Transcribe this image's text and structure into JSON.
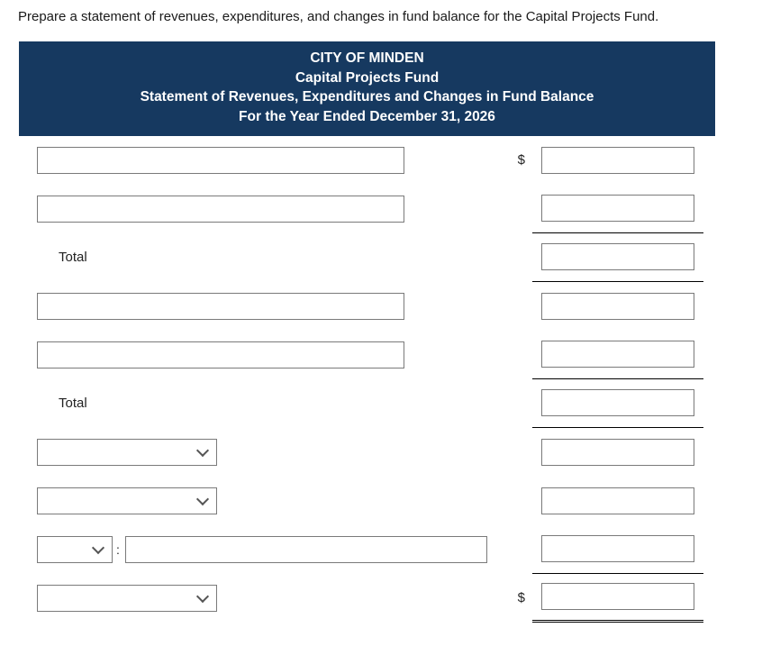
{
  "instruction": "Prepare a statement of revenues, expenditures, and changes in fund balance for the Capital Projects Fund.",
  "header": {
    "line1": "CITY OF MINDEN",
    "line2": "Capital Projects Fund",
    "line3": "Statement of Revenues, Expenditures and Changes in Fund Balance",
    "line4": "For the Year Ended December 31, 2026"
  },
  "symbols": {
    "dollar": "$",
    "colon": ":"
  },
  "labels": {
    "total": "Total"
  },
  "rows": {
    "r1": {
      "desc": "",
      "amount": ""
    },
    "r2": {
      "desc": "",
      "amount": ""
    },
    "r3": {
      "amount": ""
    },
    "r4": {
      "desc": "",
      "amount": ""
    },
    "r5": {
      "desc": "",
      "amount": ""
    },
    "r6": {
      "amount": ""
    },
    "r7": {
      "select": "",
      "amount": ""
    },
    "r8": {
      "select": "",
      "amount": ""
    },
    "r9": {
      "select": "",
      "desc": "",
      "amount": ""
    },
    "r10": {
      "select": "",
      "amount": ""
    }
  }
}
